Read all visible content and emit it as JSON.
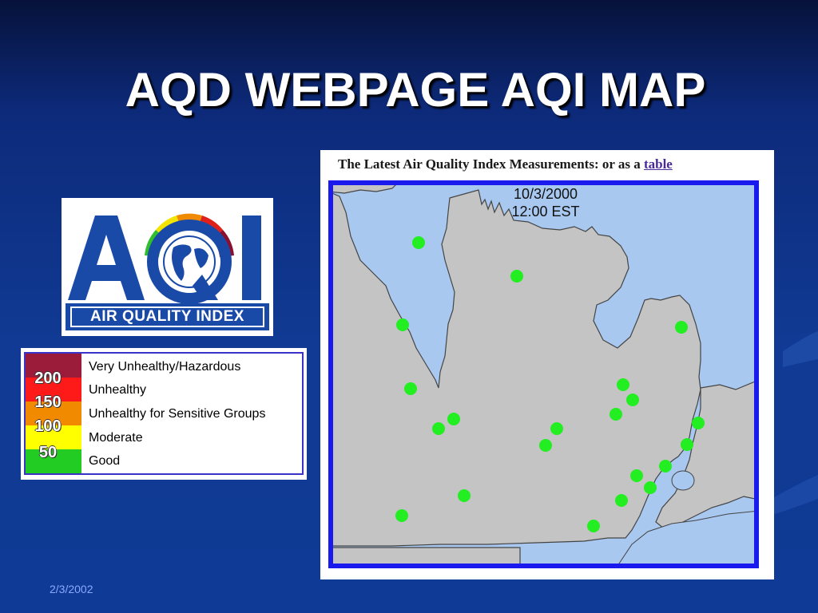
{
  "slide": {
    "title": "AQD WEBPAGE AQI MAP",
    "footer_date": "2/3/2002"
  },
  "logo": {
    "letters": "AQI",
    "banner": "AIR QUALITY INDEX",
    "colors": {
      "blue": "#1a4aa8",
      "green": "#2fbf2a",
      "yellow": "#f2e400",
      "orange": "#f08a00",
      "red": "#e0201a",
      "maroon": "#8a1030"
    }
  },
  "legend": {
    "items": [
      {
        "label": "Very Unhealthy/Hazardous",
        "color": "#9b1b3a"
      },
      {
        "value": "200",
        "label": "Unhealthy",
        "color": "#ff1a1a"
      },
      {
        "value": "150",
        "label": "Unhealthy for Sensitive Groups",
        "color": "#f28a00"
      },
      {
        "value": "100",
        "label": "Moderate",
        "color": "#ffff00"
      },
      {
        "value": "50",
        "label": "Good",
        "color": "#22cc22"
      }
    ]
  },
  "map": {
    "header_text": "The Latest Air Quality Index Measurements: or as a ",
    "header_link": "table",
    "date": "10/3/2000",
    "time": "12:00 EST",
    "colors": {
      "water": "#a8c8f0",
      "land": "#c4c4c4",
      "border": "#1a1aee",
      "monitor": "#22ee22"
    },
    "monitor_status": "Good"
  }
}
